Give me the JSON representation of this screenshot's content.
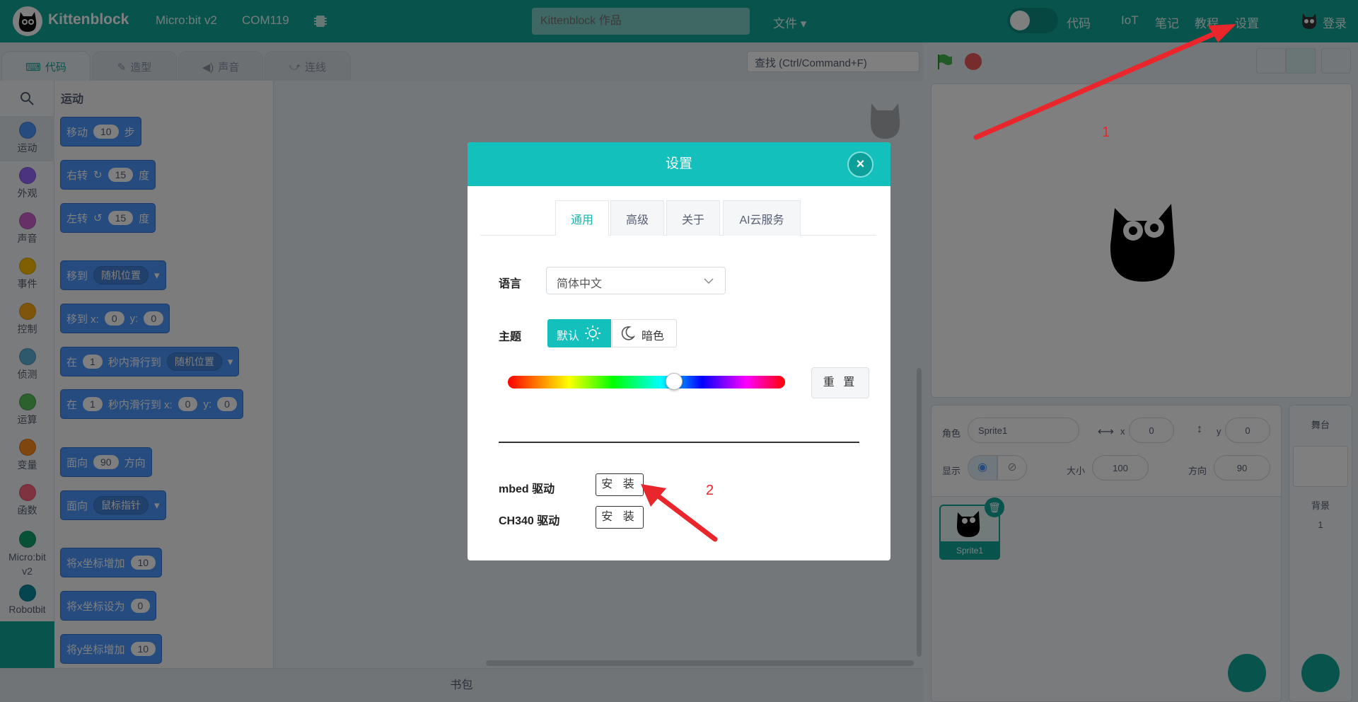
{
  "topbar": {
    "brand": "Kittenblock",
    "device": "Micro:bit v2",
    "port": "COM119",
    "project_placeholder": "Kittenblock 作品",
    "file_menu": "文件",
    "code_label": "代码",
    "nav": [
      "IoT",
      "笔记",
      "教程",
      "设置"
    ],
    "login": "登录"
  },
  "tabs": [
    {
      "label": "代码",
      "icon": "code-icon"
    },
    {
      "label": "造型",
      "icon": "brush-icon"
    },
    {
      "label": "声音",
      "icon": "speaker-icon"
    },
    {
      "label": "连线",
      "icon": "wire-icon"
    }
  ],
  "search_label": "查找 (Ctrl/Command+F)",
  "categories": [
    {
      "label": "运动",
      "color": "#4c97ff"
    },
    {
      "label": "外观",
      "color": "#9966ff"
    },
    {
      "label": "声音",
      "color": "#cf63cf"
    },
    {
      "label": "事件",
      "color": "#ffbf00"
    },
    {
      "label": "控制",
      "color": "#ffab19"
    },
    {
      "label": "侦测",
      "color": "#5cb1d6"
    },
    {
      "label": "运算",
      "color": "#59c059"
    },
    {
      "label": "变量",
      "color": "#ff8c1a"
    },
    {
      "label": "函数",
      "color": "#ff6680"
    },
    {
      "label": "Micro:bit v2",
      "color": "#0fa36e"
    },
    {
      "label": "Robotbit",
      "color": "#0a8aa0"
    }
  ],
  "palette": {
    "heading": "运动",
    "blocks": {
      "move": [
        "移动",
        "10",
        "步"
      ],
      "turn_right": [
        "右转",
        "15",
        "度"
      ],
      "turn_left": [
        "左转",
        "15",
        "度"
      ],
      "goto": [
        "移到",
        "随机位置"
      ],
      "goto_xy": [
        "移到 x:",
        "0",
        "y:",
        "0"
      ],
      "glide": [
        "在",
        "1",
        "秒内滑行到",
        "随机位置"
      ],
      "glide_xy": [
        "在",
        "1",
        "秒内滑行到 x:",
        "0",
        "y:",
        "0"
      ],
      "point_dir": [
        "面向",
        "90",
        "方向"
      ],
      "point_towards": [
        "面向",
        "鼠标指针"
      ],
      "change_x": [
        "将x坐标增加",
        "10"
      ],
      "set_x": [
        "将x坐标设为",
        "0"
      ],
      "change_y": [
        "将y坐标增加",
        "10"
      ]
    }
  },
  "backpack": "书包",
  "sprite_info": {
    "sprite_label": "角色",
    "sprite_name": "Sprite1",
    "x_label": "x",
    "x": "0",
    "y_label": "y",
    "y": "0",
    "show_label": "显示",
    "size_label": "大小",
    "size": "100",
    "direction_label": "方向",
    "direction": "90",
    "thumb_name": "Sprite1"
  },
  "stage_panel": {
    "title": "舞台",
    "backdrops_label": "背景",
    "backdrops_count": "1"
  },
  "dialog": {
    "title": "设置",
    "close": "×",
    "tabs": [
      "通用",
      "高级",
      "关于",
      "AI云服务"
    ],
    "language_label": "语言",
    "language_value": "简体中文",
    "theme_label": "主题",
    "theme_default": "默认",
    "theme_dark": "暗色",
    "hue_value": 0.6,
    "reset": "重 置",
    "drivers": [
      {
        "label": "mbed 驱动",
        "button": "安 装"
      },
      {
        "label": "CH340 驱动",
        "button": "安 装"
      }
    ]
  },
  "annotations": {
    "one": "1",
    "two": "2"
  },
  "colors": {
    "accent": "#13a79b",
    "dialog_header": "#13c0bc",
    "annotation": "#e8262b"
  }
}
